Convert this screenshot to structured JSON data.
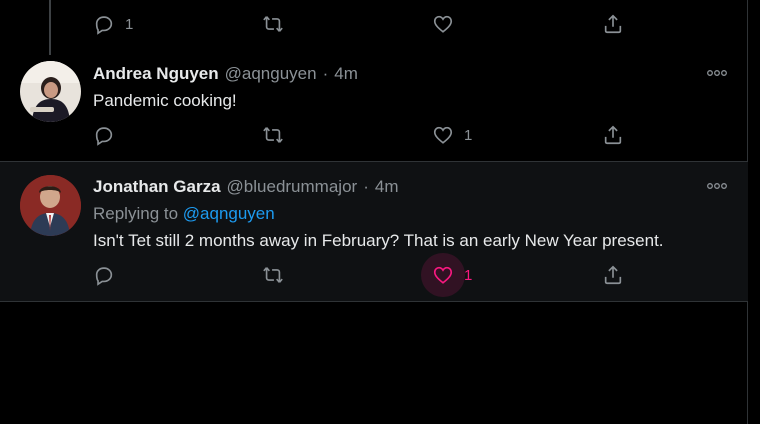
{
  "top_tweet_actions": {
    "reply_count": "1",
    "retweet_count": "",
    "like_count": "",
    "share_count": ""
  },
  "tweets": [
    {
      "author_name": "Andrea Nguyen",
      "handle": "@aqnguyen",
      "separator": "·",
      "time": "4m",
      "text": "Pandemic cooking!",
      "reply_count": "",
      "retweet_count": "",
      "like_count": "1",
      "liked": false
    },
    {
      "author_name": "Jonathan Garza",
      "handle": "@bluedrummajor",
      "separator": "·",
      "time": "4m",
      "replying_prefix": "Replying to ",
      "replying_to": "@aqnguyen",
      "text": "Isn't Tet  still 2 months away in February?  That is an early New Year present.",
      "reply_count": "",
      "retweet_count": "",
      "like_count": "1",
      "liked": true
    }
  ],
  "icons": {
    "reply": "reply-icon",
    "retweet": "retweet-icon",
    "like": "heart-icon",
    "share": "share-icon",
    "more": "more-icon"
  },
  "colors": {
    "background": "#000000",
    "accent_blue": "#1d9bf0",
    "like_pink": "#f91880",
    "muted": "#8b9196"
  }
}
